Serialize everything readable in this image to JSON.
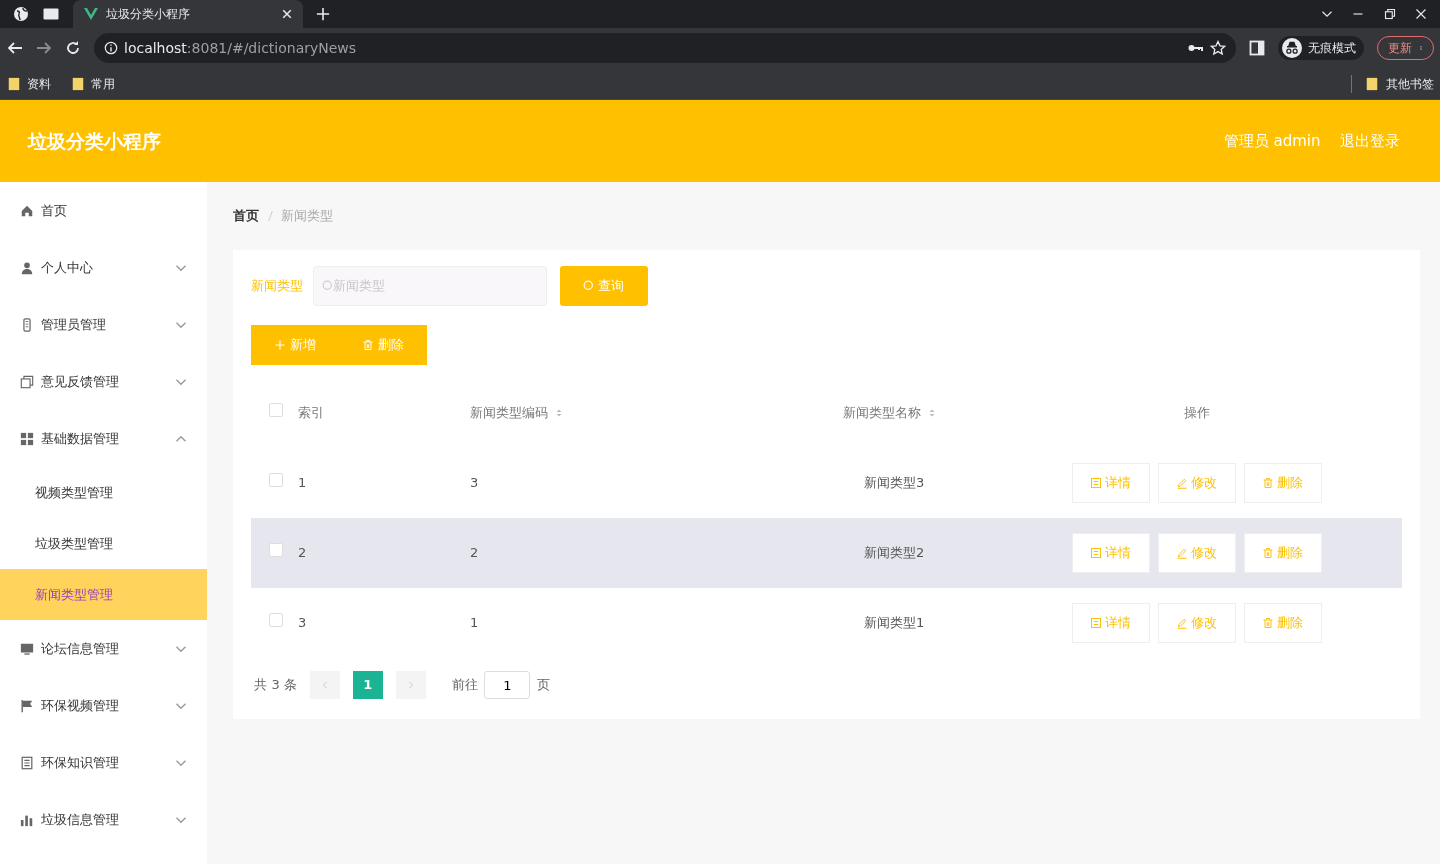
{
  "browser": {
    "tab_title": "垃圾分类小程序",
    "url_host": "localhost",
    "url_rest": ":8081/#/dictionaryNews",
    "incognito_label": "无痕模式",
    "update_button": "更新",
    "bookmarks": [
      "资料",
      "常用"
    ],
    "other_bookmarks": "其他书签"
  },
  "header": {
    "title": "垃圾分类小程序",
    "user": "管理员 admin",
    "logout": "退出登录"
  },
  "sidebar": {
    "items": [
      {
        "label": "首页",
        "kind": "link"
      },
      {
        "label": "个人中心",
        "kind": "group",
        "expanded": false
      },
      {
        "label": "管理员管理",
        "kind": "group",
        "expanded": false
      },
      {
        "label": "意见反馈管理",
        "kind": "group",
        "expanded": false
      },
      {
        "label": "基础数据管理",
        "kind": "group",
        "expanded": true,
        "children": [
          {
            "label": "视频类型管理",
            "selected": false
          },
          {
            "label": "垃圾类型管理",
            "selected": false
          },
          {
            "label": "新闻类型管理",
            "selected": true
          }
        ]
      },
      {
        "label": "论坛信息管理",
        "kind": "group",
        "expanded": false
      },
      {
        "label": "环保视频管理",
        "kind": "group",
        "expanded": false
      },
      {
        "label": "环保知识管理",
        "kind": "group",
        "expanded": false
      },
      {
        "label": "垃圾信息管理",
        "kind": "group",
        "expanded": false
      }
    ]
  },
  "breadcrumb": [
    "首页",
    "新闻类型"
  ],
  "search": {
    "label": "新闻类型",
    "placeholder": "新闻类型",
    "button": "查询"
  },
  "actions": [
    {
      "label": "新增",
      "kind": "add"
    },
    {
      "label": "删除",
      "kind": "delete"
    }
  ],
  "table": {
    "all_checked": false,
    "columns": [
      {
        "label": "索引",
        "sortable": false
      },
      {
        "label": "新闻类型编码",
        "sortable": true
      },
      {
        "label": "新闻类型名称",
        "sortable": true
      },
      {
        "label": "操作",
        "sortable": false
      }
    ],
    "rows": [
      {
        "index": "1",
        "code": "3",
        "name": "新闻类型3",
        "checked": false,
        "highlighted": false,
        "actions": [
          {
            "label": "详情",
            "kind": "detail"
          },
          {
            "label": "修改",
            "kind": "edit"
          },
          {
            "label": "删除",
            "kind": "delete"
          }
        ]
      },
      {
        "index": "2",
        "code": "2",
        "name": "新闻类型2",
        "checked": false,
        "highlighted": true,
        "actions": [
          {
            "label": "详情",
            "kind": "detail"
          },
          {
            "label": "修改",
            "kind": "edit"
          },
          {
            "label": "删除",
            "kind": "delete"
          }
        ]
      },
      {
        "index": "3",
        "code": "1",
        "name": "新闻类型1",
        "checked": false,
        "highlighted": false,
        "actions": [
          {
            "label": "详情",
            "kind": "detail"
          },
          {
            "label": "修改",
            "kind": "edit"
          },
          {
            "label": "删除",
            "kind": "delete"
          }
        ]
      }
    ]
  },
  "pagination": {
    "total": "共 3 条",
    "pages": [
      {
        "label": "1",
        "selected": true
      }
    ],
    "goto_label": "前往",
    "goto_value": "1",
    "goto_suffix": "页"
  }
}
